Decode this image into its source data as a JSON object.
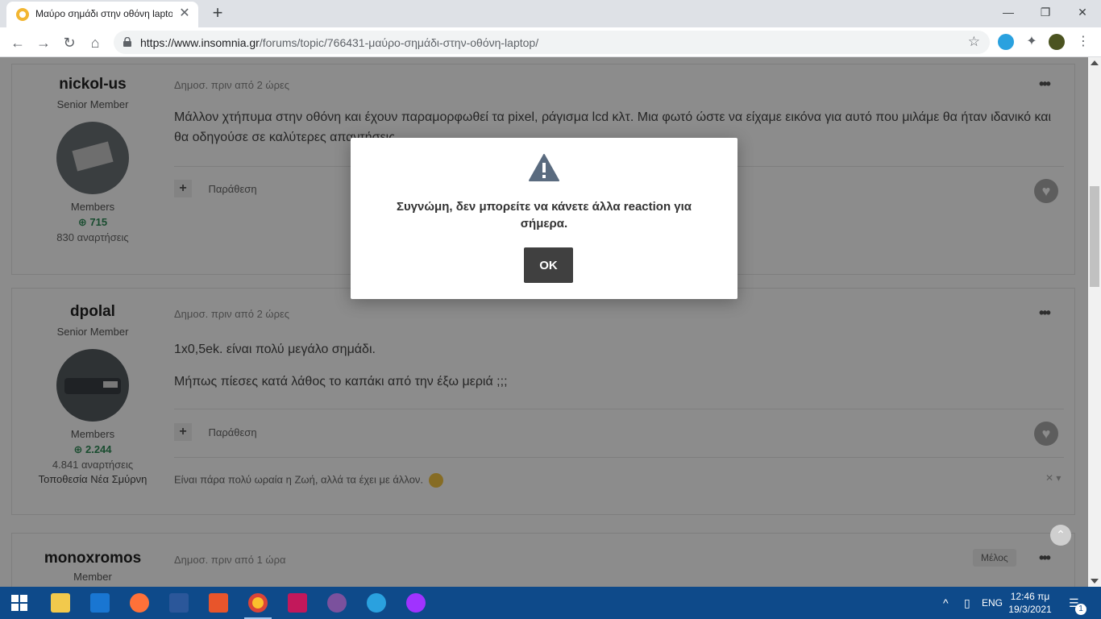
{
  "browser": {
    "tab_title": "Μαύρο σημάδι στην οθόνη laptop",
    "tab_close": "✕",
    "new_tab": "+",
    "url_host": "https://www.insomnia.gr",
    "url_path": "/forums/topic/766431-μαύρο-σημάδι-στην-οθόνη-laptop/",
    "window_controls": {
      "minimize": "—",
      "restore": "❐",
      "close": "✕"
    }
  },
  "posts": [
    {
      "author": "nickol-us",
      "rank": "Senior Member",
      "group": "Members",
      "reputation": "715",
      "post_count": "830 αναρτήσεις",
      "location": "",
      "date": "Δημοσ. πριν από 2 ώρες",
      "paragraphs": [
        "Μάλλον χτήπυμα στην οθόνη και έχουν παραμορφωθεί τα pixel, ράγισμα lcd κλτ. Μια φωτό ώστε να είχαμε εικόνα για αυτό που μιλάμε θα ήταν ιδανικό και θα οδηγούσε σε καλύτερες απαντήσεις"
      ],
      "quote_label": "Παράθεση",
      "signature": ""
    },
    {
      "author": "dpolal",
      "rank": "Senior Member",
      "group": "Members",
      "reputation": "2.244",
      "post_count": "4.841 αναρτήσεις",
      "location": "Τοποθεσία Νέα Σμύρνη",
      "date": "Δημοσ. πριν από 2 ώρες",
      "paragraphs": [
        "1x0,5ek. είναι πολύ μεγάλο σημάδι.",
        "Μήπως πίεσες κατά λάθος το καπάκι από την έξω μεριά ;;;"
      ],
      "quote_label": "Παράθεση",
      "signature": "Είναι πάρα πολύ ωραία η Ζωή, αλλά τα έχει με άλλον."
    },
    {
      "author": "monoxromos",
      "rank": "Member",
      "date": "Δημοσ. πριν από 1 ώρα",
      "badge": "Μέλος"
    }
  ],
  "modal": {
    "message": "Συγνώμη, δεν μπορείτε να κάνετε άλλα reaction για σήμερα.",
    "ok_label": "OK"
  },
  "taskbar": {
    "language": "ENG",
    "time": "12:46 πμ",
    "date": "19/3/2021",
    "notifications": "1"
  },
  "colors": {
    "reputation_green": "#2e8b57",
    "taskbar_blue": "#0e4a8a",
    "ok_button": "#404040",
    "warning_icon": "#5a6b7f"
  }
}
